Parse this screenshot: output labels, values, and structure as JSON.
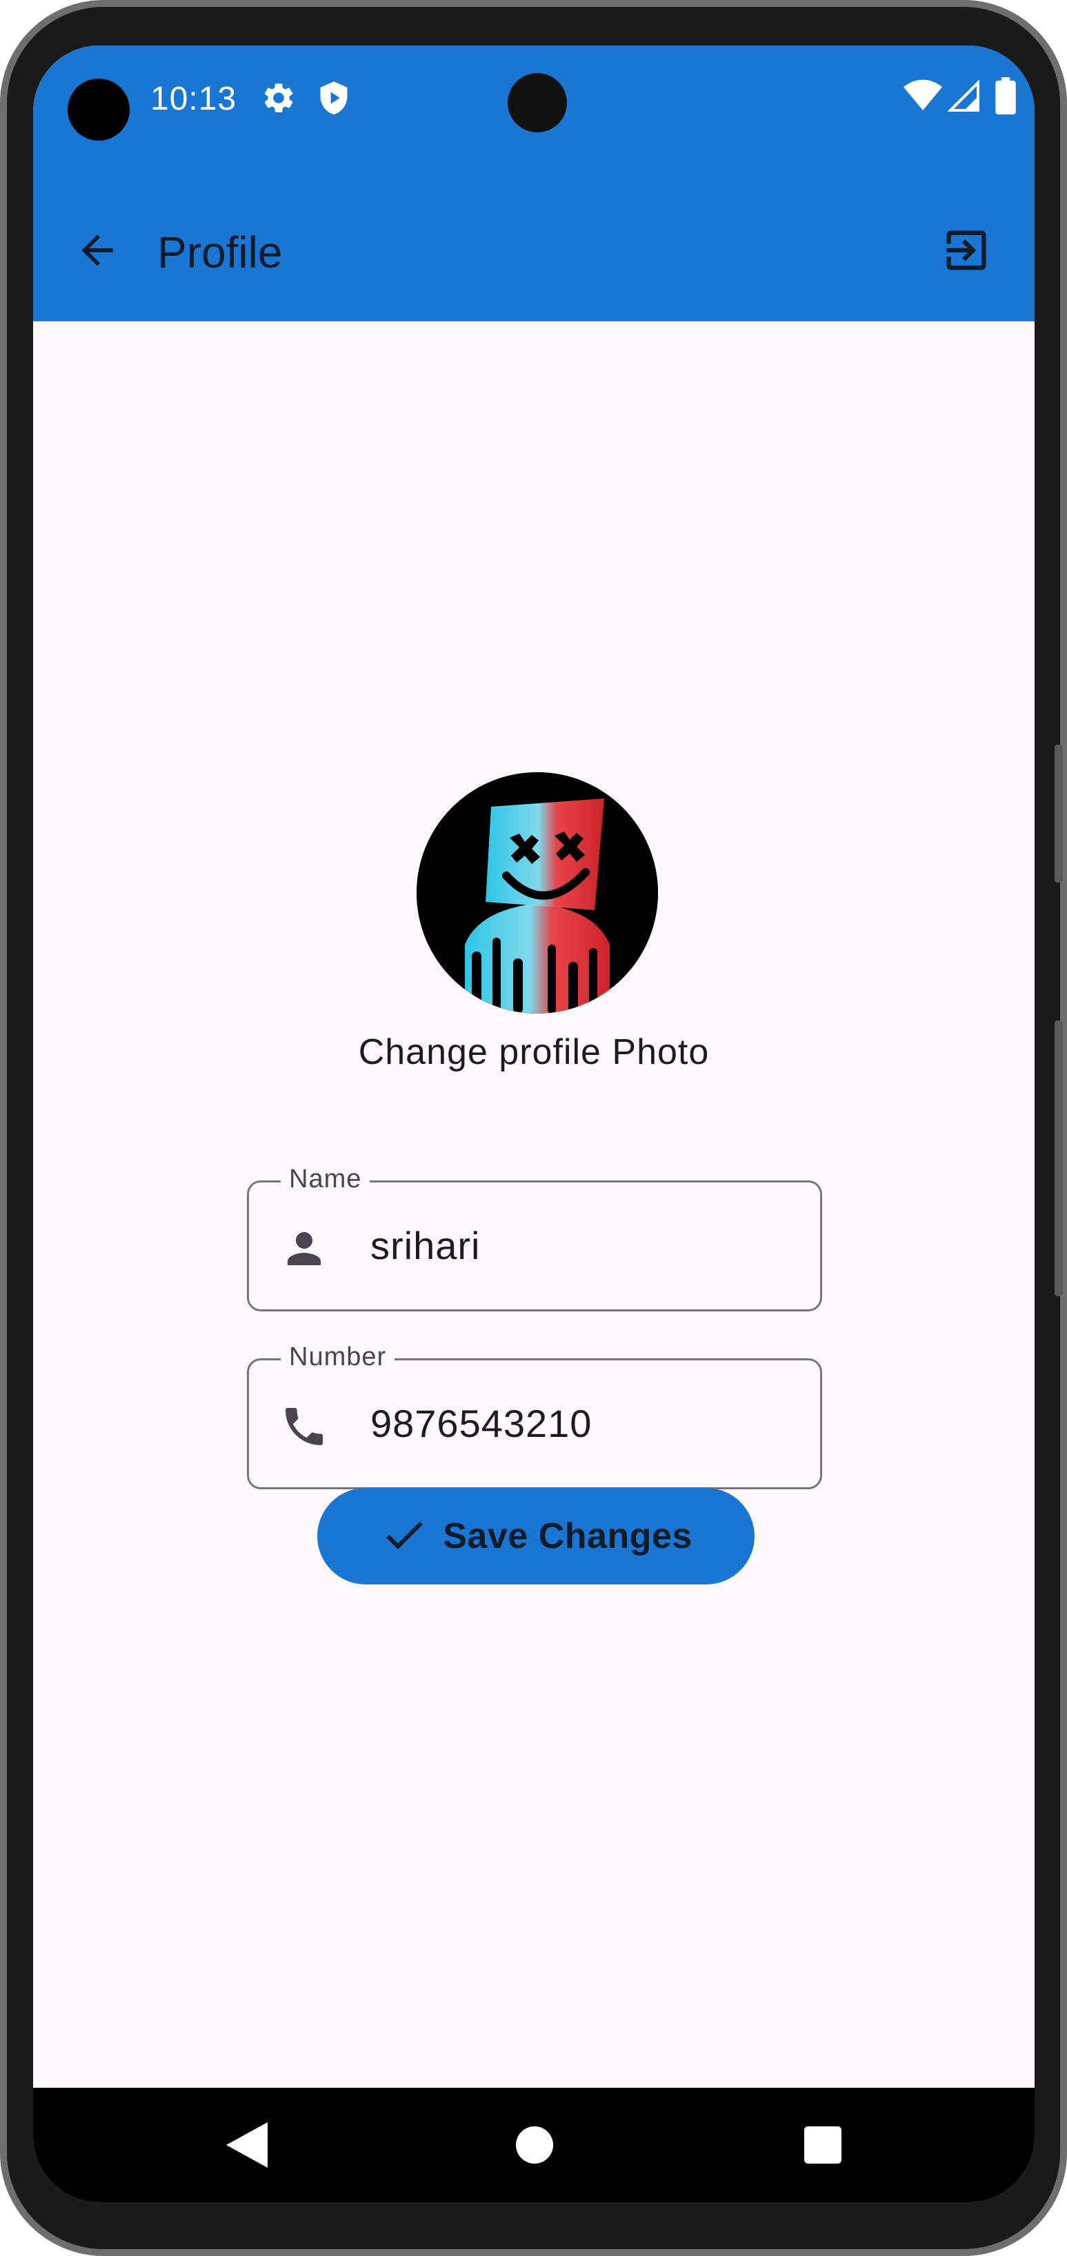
{
  "status_bar": {
    "time": "10:13",
    "icons": [
      "settings-icon",
      "shield-play-icon",
      "wifi-icon",
      "signal-icon",
      "battery-icon"
    ]
  },
  "app_bar": {
    "title": "Profile",
    "back_icon": "arrow-back-icon",
    "logout_icon": "exit-to-app-icon"
  },
  "profile": {
    "change_photo_label": "Change profile Photo",
    "fields": [
      {
        "label": "Name",
        "value": "srihari",
        "icon": "person-icon"
      },
      {
        "label": "Number",
        "value": "9876543210",
        "icon": "phone-icon"
      }
    ],
    "save_label": "Save Changes",
    "save_icon": "check-icon"
  },
  "nav_bar": {
    "icons": [
      "back-triangle-icon",
      "home-circle-icon",
      "recents-square-icon"
    ]
  },
  "colors": {
    "primary": "#1976d2",
    "background": "#fdf8fb",
    "outline": "#79747e",
    "on_primary_text": "#0d1b2a"
  }
}
